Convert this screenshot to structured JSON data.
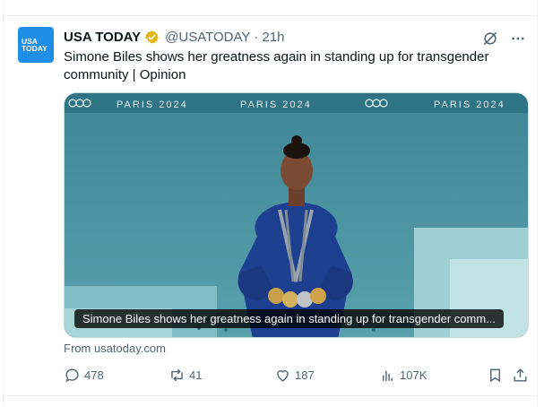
{
  "tweet": {
    "author": {
      "avatar_text_line1": "USA",
      "avatar_text_line2": "TODAY",
      "name": "USA TODAY",
      "handle": "@USATODAY",
      "separator": "·",
      "time": "21h",
      "verified": true
    },
    "text": "Simone Biles shows her greatness again in standing up for transgender community | Opinion",
    "card": {
      "caption": "Simone Biles shows her greatness again in standing up for transgender comm...",
      "backdrop_labels": [
        "PARIS 2024",
        "PARIS 2024",
        "PARIS 2024"
      ],
      "source": "From usatoday.com"
    },
    "actions": {
      "replies": "478",
      "reposts": "41",
      "likes": "187",
      "views": "107K"
    }
  },
  "colors": {
    "accent": "#1e8ee6",
    "muted": "#536471",
    "text": "#0f1419",
    "verified_gold": "#e2b719"
  },
  "icons": [
    "grok-icon",
    "more-icon",
    "reply-icon",
    "repost-icon",
    "like-icon",
    "views-icon",
    "bookmark-icon",
    "share-icon"
  ]
}
